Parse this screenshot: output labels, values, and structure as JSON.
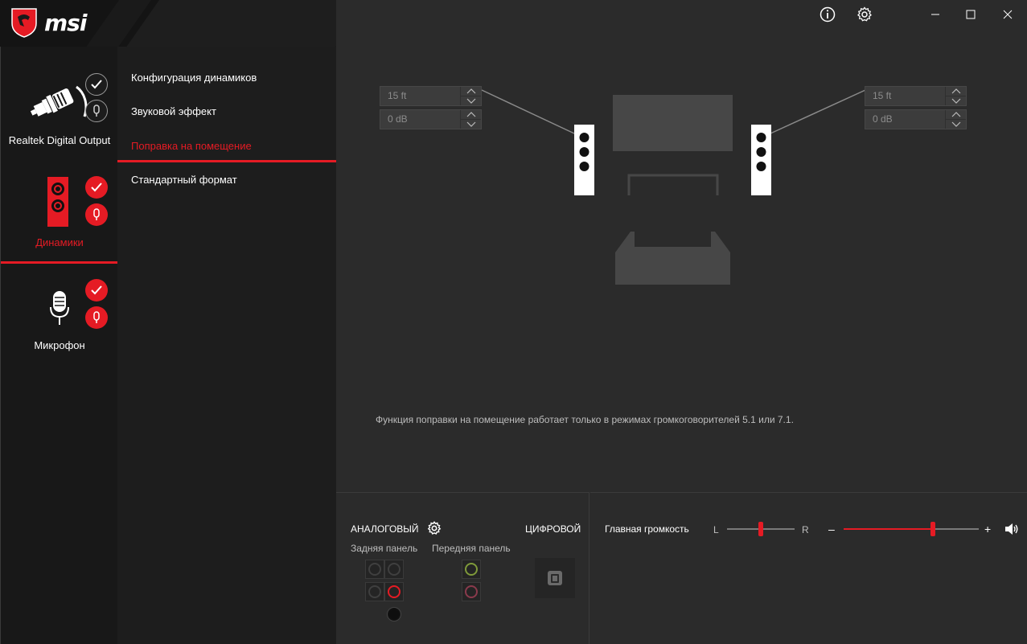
{
  "app": {
    "logo_text": "msi",
    "colors": {
      "accent": "#e51b24",
      "background": "#2b2b2b",
      "sidebar": "#181818",
      "submenu": "#1d1d1d"
    }
  },
  "window_controls": {
    "info_icon": "info-icon",
    "settings_icon": "gear-icon",
    "minimize": "minimize-icon",
    "maximize": "maximize-icon",
    "close": "close-icon"
  },
  "devices": [
    {
      "label": "Realtek Digital Output",
      "icon": "spdif-cable-icon",
      "active": false
    },
    {
      "label": "Динамики",
      "icon": "speaker-icon",
      "active": true
    },
    {
      "label": "Микрофон",
      "icon": "microphone-icon",
      "active": false
    }
  ],
  "submenu": {
    "items": [
      {
        "label": "Конфигурация динамиков",
        "active": false
      },
      {
        "label": "Звуковой эффект",
        "active": false
      },
      {
        "label": "Поправка на помещение",
        "active": true
      },
      {
        "label": "Стандартный формат",
        "active": false
      }
    ]
  },
  "room_correction": {
    "left": {
      "distance": "15 ft",
      "gain": "0 dB"
    },
    "right": {
      "distance": "15 ft",
      "gain": "0 dB"
    },
    "note": "Функция поправки на помещение работает только в режимах громкоговорителей 5.1 или 7.1."
  },
  "connectors": {
    "analog_label": "АНАЛОГОВЫЙ",
    "digital_label": "ЦИФРОВОЙ",
    "rear_panel_label": "Задняя панель",
    "front_panel_label": "Передняя панель"
  },
  "volume": {
    "master_label": "Главная громкость",
    "balance_left": "L",
    "balance_right": "R",
    "minus": "–",
    "plus": "+",
    "balance_value": 0.5,
    "volume_value": 0.66
  }
}
